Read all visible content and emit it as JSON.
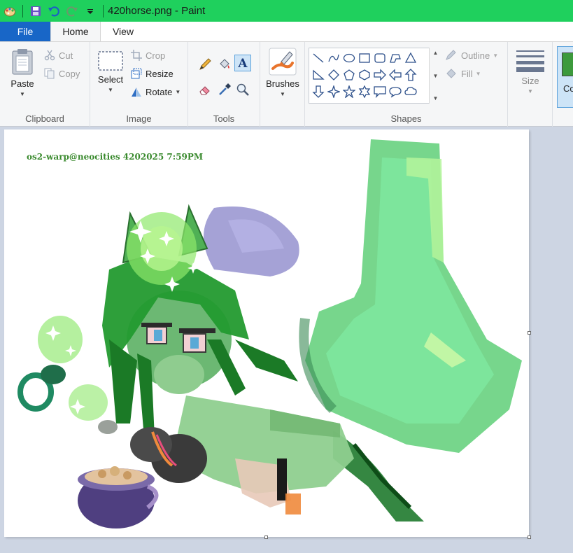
{
  "window": {
    "title": "420horse.png - Paint"
  },
  "tabs": [
    {
      "label": "File"
    },
    {
      "label": "Home"
    },
    {
      "label": "View"
    }
  ],
  "ribbon": {
    "clipboard": {
      "label": "Clipboard",
      "paste": "Paste",
      "cut": "Cut",
      "copy": "Copy"
    },
    "image": {
      "label": "Image",
      "select": "Select",
      "crop": "Crop",
      "resize": "Resize",
      "rotate": "Rotate"
    },
    "tools": {
      "label": "Tools"
    },
    "brushes": {
      "label": "Brushes"
    },
    "shapes": {
      "label": "Shapes",
      "outline": "Outline",
      "fill": "Fill"
    },
    "size": {
      "label": "Size"
    },
    "colors": {
      "label": "Co",
      "active_color": "#3c9a3c"
    }
  },
  "canvas": {
    "watermark": "os2-warp@neocities 4202025 7:59PM"
  },
  "colors": {
    "titlebar": "#1fd05d",
    "file_tab": "#1866c7",
    "ribbon_bg": "#f5f6f7",
    "workspace": "#cdd5e3"
  }
}
